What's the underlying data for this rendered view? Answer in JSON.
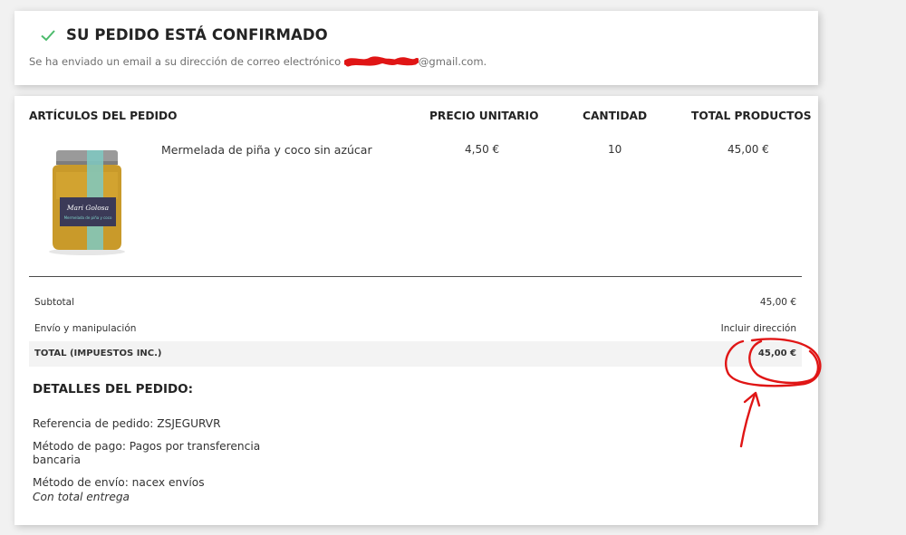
{
  "confirmation": {
    "title": "SU PEDIDO ESTÁ CONFIRMADO",
    "message_prefix": "Se ha enviado un email a su dirección de correo electrónico",
    "email_suffix": "@gmail.com."
  },
  "table": {
    "headers": {
      "items": "ARTÍCULOS DEL PEDIDO",
      "unit_price": "PRECIO UNITARIO",
      "quantity": "CANTIDAD",
      "total": "TOTAL PRODUCTOS"
    },
    "rows": [
      {
        "name": "Mermelada de piña y coco sin azúcar",
        "unit_price": "4,50 €",
        "quantity": "10",
        "total": "45,00 €",
        "image_icon": "jam-jar-product-photo",
        "image_label": "Mari Golosa",
        "image_sublabel": "Mermelada de piña y coco"
      }
    ]
  },
  "summary": {
    "subtotal_label": "Subtotal",
    "subtotal_value": "45,00 €",
    "shipping_label": "Envío y manipulación",
    "shipping_value": "Incluir dirección",
    "total_label": "TOTAL (IMPUESTOS INC.)",
    "total_value": "45,00 €"
  },
  "details": {
    "title": "DETALLES DEL PEDIDO:",
    "reference": "Referencia de pedido: ZSJEGURVR",
    "payment": "Método de pago: Pagos por transferencia bancaria",
    "shipping": "Método de envío: nacex envíos",
    "shipping_note": "Con total entrega"
  },
  "colors": {
    "check": "#4cbb6c",
    "annotation_red": "#e01515",
    "total_row_bg": "#f3f3f3"
  },
  "icons": {
    "check": "check-icon"
  }
}
